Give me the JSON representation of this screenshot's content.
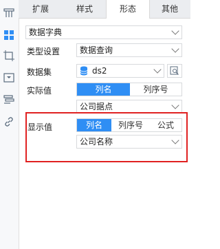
{
  "tabs": [
    {
      "label": "扩展",
      "active": false
    },
    {
      "label": "样式",
      "active": false
    },
    {
      "label": "形态",
      "active": true
    },
    {
      "label": "其他",
      "active": false
    }
  ],
  "sidebar_icons": [
    "grid-header-icon",
    "widget-icon",
    "crop-icon",
    "dropdown-box-icon",
    "layers-icon",
    "link-icon"
  ],
  "data_type": {
    "value": "数据字典"
  },
  "type_setting": {
    "label": "类型设置",
    "value": "数据查询"
  },
  "dataset": {
    "label": "数据集",
    "value": "ds2"
  },
  "actual_value": {
    "label": "实际值",
    "options": [
      "列名",
      "列序号"
    ],
    "selected": "列名",
    "field_value": "公司据点"
  },
  "display_value": {
    "label": "显示值",
    "options": [
      "列名",
      "列序号",
      "公式"
    ],
    "selected": "列名",
    "field_value": "公司名称"
  },
  "colors": {
    "accent": "#2f8ef4",
    "highlight": "#e02020",
    "dataset_icon": "#2f8ef4"
  }
}
